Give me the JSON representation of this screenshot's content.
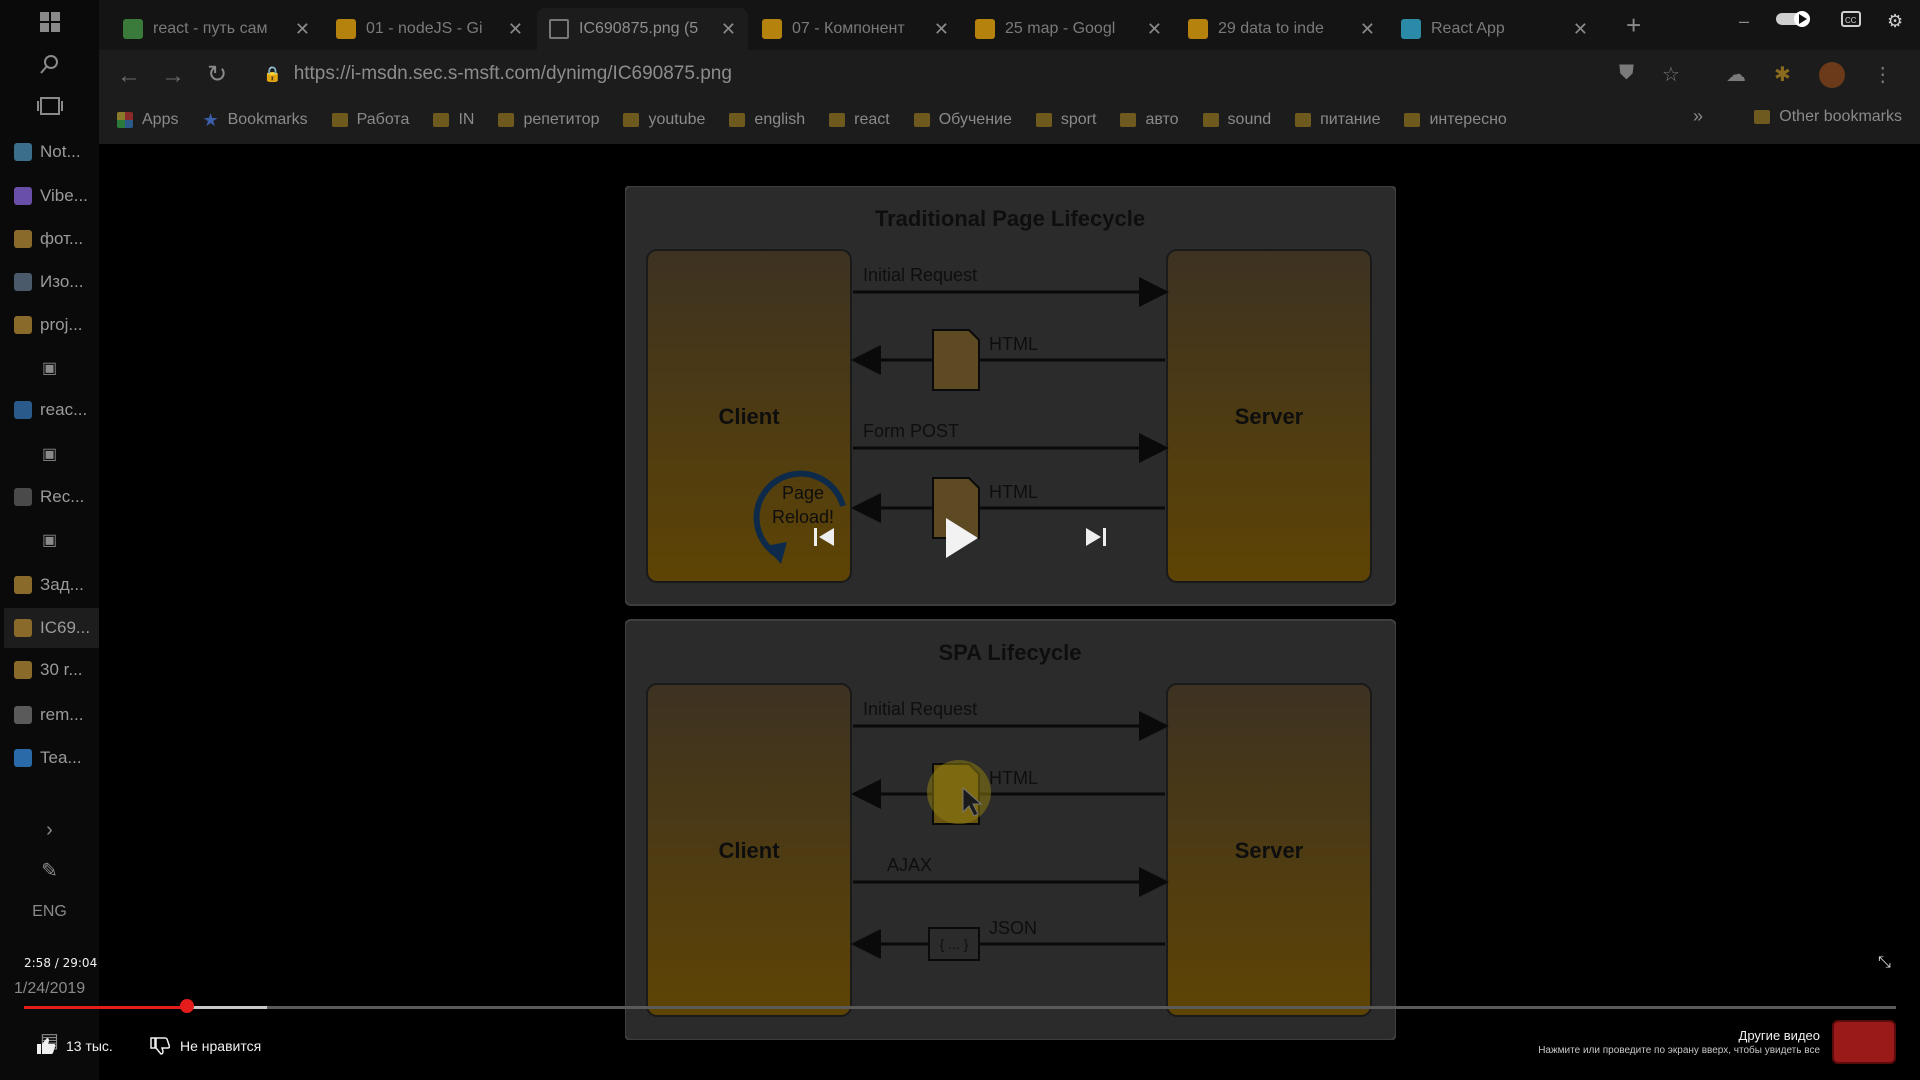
{
  "taskbar": {
    "apps": [
      {
        "label": "Not...",
        "color": "#3a6e8a",
        "active": false
      },
      {
        "label": "Vibe...",
        "color": "#6a4fa8",
        "active": false
      },
      {
        "label": "фот...",
        "color": "#8a6a2a",
        "active": false
      },
      {
        "label": "Изо...",
        "color": "#4a5a6a",
        "active": false
      },
      {
        "label": "proj...",
        "color": "#8a6a2a",
        "active": false
      },
      {
        "label": "reac...",
        "color": "#2a5a8a",
        "active": false
      },
      {
        "label": "Rec...",
        "color": "#4a4a4a",
        "active": false
      },
      {
        "label": "Зад...",
        "color": "#8a6a2a",
        "active": false
      },
      {
        "label": "IC69...",
        "color": "#8a6a2a",
        "active": true
      },
      {
        "label": "30 r...",
        "color": "#8a6a2a",
        "active": false
      },
      {
        "label": "rem...",
        "color": "#5a5a5a",
        "active": false
      },
      {
        "label": "Tea...",
        "color": "#2a6aa8",
        "active": false
      }
    ],
    "language": "ENG",
    "date": "1/24/2019"
  },
  "browser": {
    "tabs": [
      {
        "label": "react - путь сам",
        "icon": "drive-icon",
        "active": false
      },
      {
        "label": "01 - nodeJS - Gi",
        "icon": "slides-icon",
        "active": false
      },
      {
        "label": "IC690875.png (5",
        "icon": "page-icon",
        "active": true
      },
      {
        "label": "07 - Компонент",
        "icon": "slides-icon",
        "active": false
      },
      {
        "label": "25 map - Googl",
        "icon": "slides-icon",
        "active": false
      },
      {
        "label": "29 data to inde",
        "icon": "slides-icon",
        "active": false
      },
      {
        "label": "React App",
        "icon": "react-icon",
        "active": false
      }
    ],
    "url": "https://i-msdn.sec.s-msft.com/dynimg/IC690875.png",
    "bookmarks": [
      "Apps",
      "Bookmarks",
      "Работа",
      "IN",
      "репетитор",
      "youtube",
      "english",
      "react",
      "Обучение",
      "sport",
      "авто",
      "sound",
      "питание",
      "интересно"
    ],
    "other_bookmarks": "Other bookmarks"
  },
  "diagram": {
    "top": {
      "title": "Traditional Page Lifecycle",
      "client": "Client",
      "server": "Server",
      "labels": [
        "Initial Request",
        "HTML",
        "Form POST",
        "HTML"
      ],
      "reload": [
        "Page",
        "Reload!"
      ]
    },
    "bottom": {
      "title": "SPA Lifecycle",
      "client": "Client",
      "server": "Server",
      "labels": [
        "Initial Request",
        "HTML",
        "AJAX",
        "JSON"
      ],
      "json_doc": "{ ... }"
    }
  },
  "player": {
    "time": "2:58 / 29:04",
    "progress_played_fraction": 0.087,
    "progress_buffered_fraction": 0.13,
    "likes": "13 тыс.",
    "dislike_label": "Не нравится",
    "other_videos_title": "Другие видео",
    "other_videos_hint": "Нажмите или проведите по экрану вверх, чтобы увидеть все"
  },
  "colors": {
    "box_fill_top": "#8a6a1c",
    "box_fill_bottom": "#5c4305",
    "panel_bg": "#2a2a2a",
    "progress_red": "#e51c1c"
  }
}
